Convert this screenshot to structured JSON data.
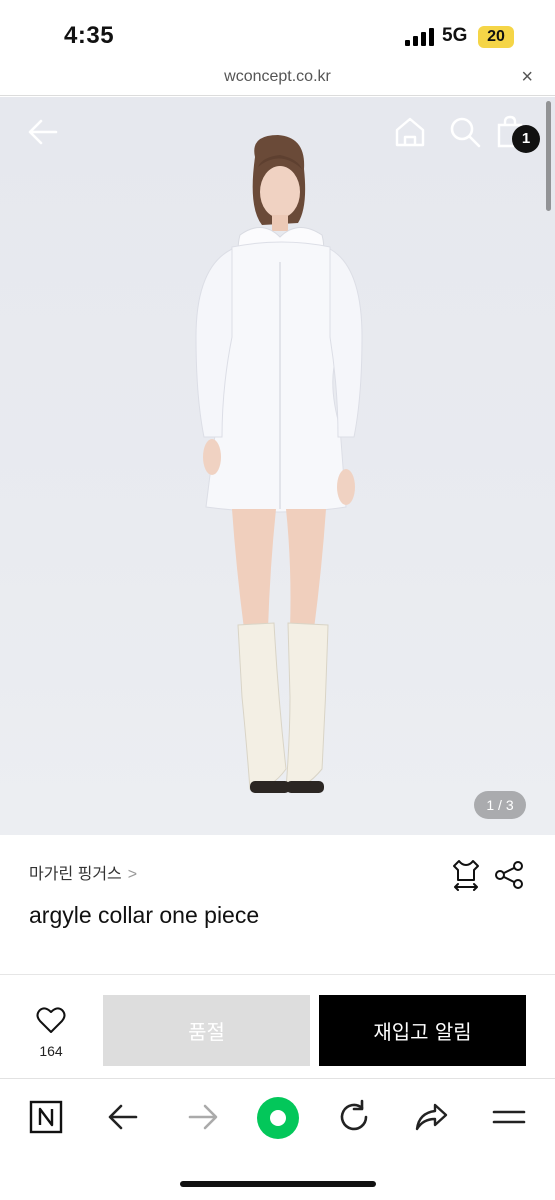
{
  "status_bar": {
    "time": "4:35",
    "network": "5G",
    "battery": "20"
  },
  "browser": {
    "url": "wconcept.co.kr",
    "close_glyph": "×"
  },
  "hero": {
    "back_icon": "arrow-left-icon",
    "home_icon": "home-icon",
    "search_icon": "search-icon",
    "bag_icon": "shopping-bag-icon",
    "cart_count": "1",
    "page_indicator": "1 / 3",
    "background_color": "#e8eaef"
  },
  "product": {
    "brand": "마가린 핑거스",
    "brand_chevron": ">",
    "name": "argyle collar one piece",
    "size_icon": "size-guide-icon",
    "share_icon": "share-icon"
  },
  "actions": {
    "like_icon": "heart-icon",
    "like_count": "164",
    "soldout_label": "품절",
    "restock_label": "재입고 알림",
    "soldout_color": "#dddddd",
    "restock_color": "#000000"
  },
  "toolbar": {
    "icons": [
      "naver-n-icon",
      "back-arrow-icon",
      "forward-arrow-icon",
      "green-dot-icon",
      "refresh-icon",
      "share-arrow-icon",
      "menu-icon"
    ],
    "accent": "#03c75a"
  }
}
